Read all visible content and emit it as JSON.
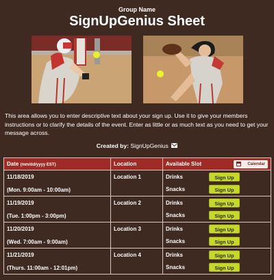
{
  "header": {
    "group_name": "Group Name",
    "title": "SignUpGenius Sheet"
  },
  "images": [
    {
      "icon": "softball-batter-photo"
    },
    {
      "icon": "softball-pitcher-photo"
    }
  ],
  "description": "This area allows you to enter descriptive text about your sign up. Use it to give your members instructions or to clarify the details of the event. Enter as little or as much text as you need to get your message across.",
  "created_by": {
    "label": "Created by:",
    "name": "SignUpGenius",
    "icon": "mail-icon"
  },
  "table": {
    "headers": {
      "date": "Date",
      "date_format": "(mm/dd/yyyy EST)",
      "location": "Location",
      "slot": "Available Slot",
      "calendar": "Calendar"
    },
    "rows": [
      {
        "date": "11/18/2019",
        "time": "(Mon. 9:00am - 10:00am)",
        "location": "Location 1",
        "slots": [
          {
            "name": "Drinks",
            "button": "Sign Up"
          },
          {
            "name": "Snacks",
            "button": "Sign Up"
          }
        ]
      },
      {
        "date": "11/19/2019",
        "time": "(Tue. 1:00pm - 3:00pm)",
        "location": "Location 2",
        "slots": [
          {
            "name": "Drinks",
            "button": "Sign Up"
          },
          {
            "name": "Snacks",
            "button": "Sign Up"
          }
        ]
      },
      {
        "date": "11/20/2019",
        "time": "(Wed. 7:00am - 9:00am)",
        "location": "Location 3",
        "slots": [
          {
            "name": "Drinks",
            "button": "Sign Up"
          },
          {
            "name": "Snacks",
            "button": "Sign Up"
          }
        ]
      },
      {
        "date": "11/21/2019",
        "time": "(Thurs. 11:00am - 12:01pm)",
        "location": "Location 4",
        "slots": [
          {
            "name": "Drinks",
            "button": "Sign Up"
          },
          {
            "name": "Snacks",
            "button": "Sign Up"
          }
        ]
      }
    ]
  },
  "colors": {
    "background": "#3f2a22",
    "header_bar": "#9e2b25",
    "signup_button": "#c6d82a"
  }
}
